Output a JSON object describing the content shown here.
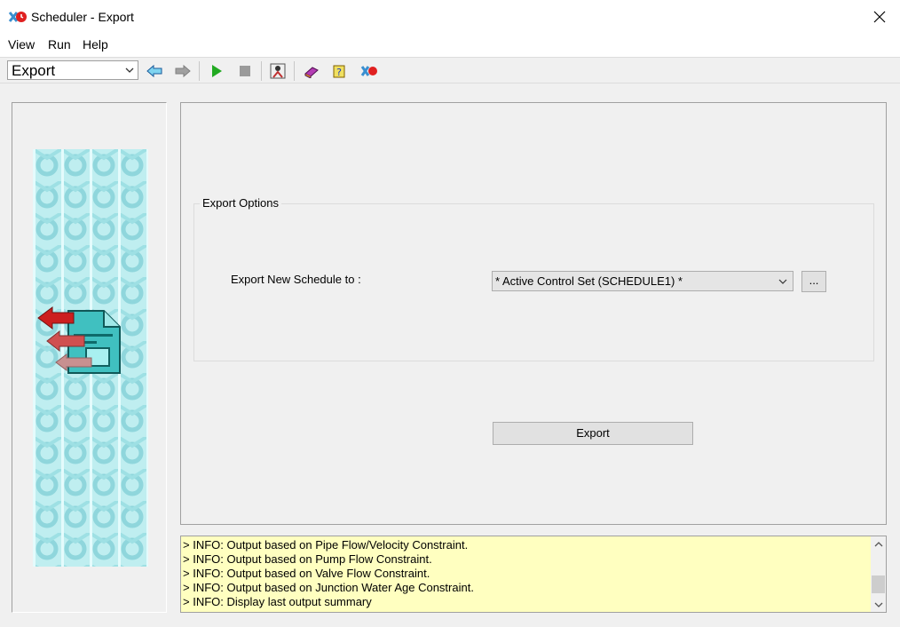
{
  "window": {
    "title": "Scheduler - Export"
  },
  "menu": [
    "View",
    "Run",
    "Help"
  ],
  "toolbar": {
    "mode_value": "Export",
    "buttons": [
      "back-arrow-icon",
      "forward-arrow-icon",
      "run-icon",
      "stop-icon",
      "schedule-person-icon",
      "book-icon",
      "help-icon",
      "scheduler-app-icon"
    ]
  },
  "export_options": {
    "group_title": "Export Options",
    "field_label": "Export New Schedule to :",
    "selected_value": "* Active Control Set (SCHEDULE1) *",
    "browse_label": "...",
    "export_label": "Export"
  },
  "log": {
    "lines": [
      "> INFO: Output based on Pipe Flow/Velocity Constraint.",
      "> INFO: Output based on Pump Flow Constraint.",
      "> INFO: Output based on Valve Flow Constraint.",
      "> INFO: Output based on Junction Water Age Constraint.",
      "> INFO: Display last output summary"
    ]
  },
  "colors": {
    "log_background": "#ffffc0",
    "banner": "#a8e4e8",
    "run_green": "#22aa22"
  }
}
